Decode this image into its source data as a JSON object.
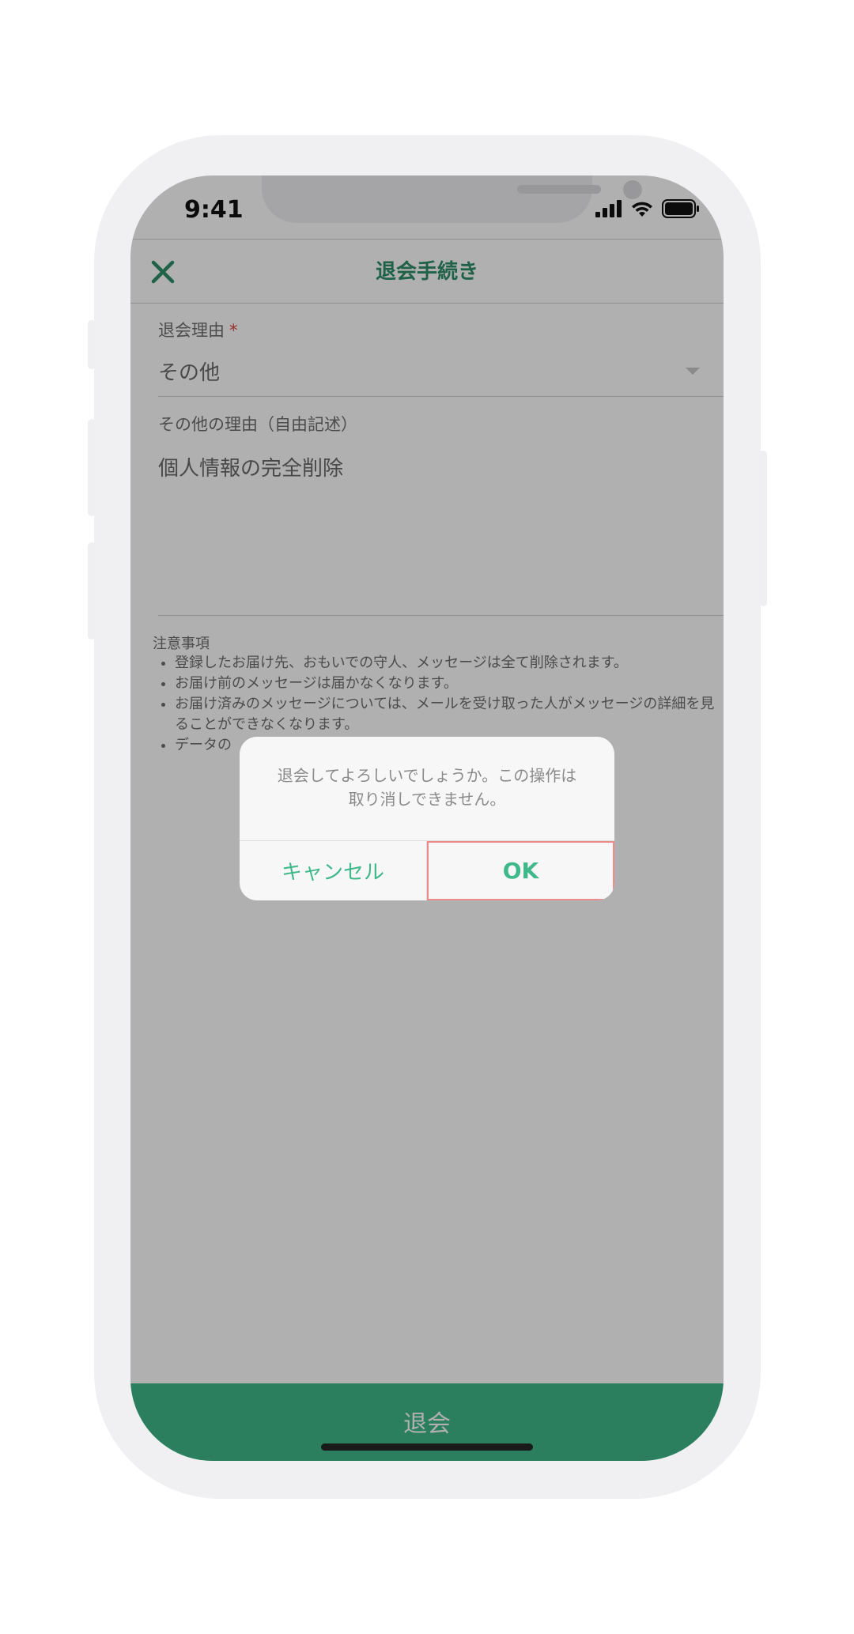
{
  "status_bar": {
    "time": "9:41"
  },
  "header": {
    "title": "退会手続き"
  },
  "form": {
    "reason_label": "退会理由",
    "required_mark": "*",
    "reason_value": "その他",
    "other_label": "その他の理由（自由記述）",
    "other_value": "個人情報の完全削除"
  },
  "notes": {
    "title": "注意事項",
    "items": [
      "登録したお届け先、おもいでの守人、メッセージは全て削除されます。",
      "お届け前のメッセージは届かなくなります。",
      "お届け済みのメッセージについては、メールを受け取った人がメッセージの詳細を見ることができなくなります。",
      "データの"
    ]
  },
  "bottom_button": {
    "label": "退会"
  },
  "dialog": {
    "message_line1": "退会してよろしいでしょうか。この操作は",
    "message_line2": "取り消しできません。",
    "cancel_label": "キャンセル",
    "ok_label": "OK"
  },
  "colors": {
    "accent": "#3fb88a",
    "header_title": "#2f8f6b",
    "required": "#e04545",
    "highlight": "#ef8a8a"
  },
  "icons": [
    "close-icon",
    "signal-icon",
    "wifi-icon",
    "battery-icon",
    "chevron-down-icon"
  ]
}
